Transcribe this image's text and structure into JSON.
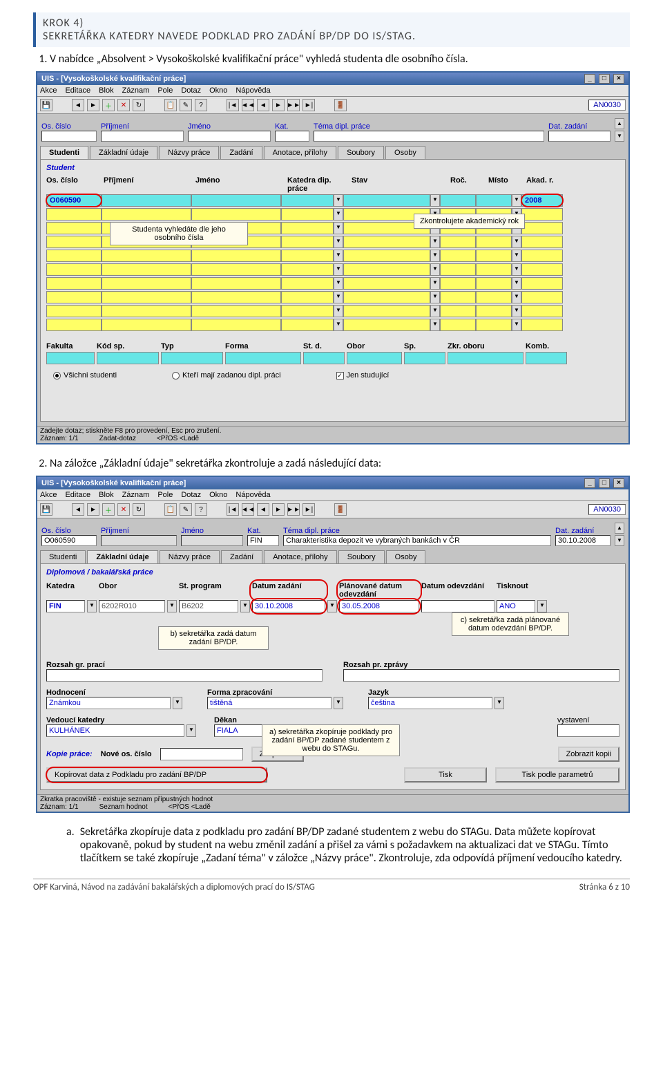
{
  "heading": {
    "step": "KROK 4)",
    "title": "SEKRETÁŘKA KATEDRY NAVEDE PODKLAD PRO ZADÁNÍ BP/DP DO IS/STAG."
  },
  "body": {
    "item1": "V nabídce „Absolvent > Vysokoškolské kvalifikační práce\" vyhledá studenta dle osobního čísla.",
    "item2": "Na záložce „Základní údaje\" sekretářka zkontroluje a zadá následující data:",
    "point_a": "Sekretářka zkopíruje data z podkladu pro zadání BP/DP zadané studentem z webu do STAGu. Data můžete kopírovat opakovaně, pokud by student na webu změnil zadání a přišel za vámi s požadavkem na aktualizaci dat ve STAGu. Tímto tlačítkem se také zkopíruje „Zadaní téma\" v záložce „Názvy práce\". Zkontroluje, zda odpovídá příjmení vedoucího katedry."
  },
  "uis": {
    "title": "UIS - [Vysokoškolské kvalifikační práce]",
    "menubar": [
      "Akce",
      "Editace",
      "Blok",
      "Záznam",
      "Pole",
      "Dotaz",
      "Okno",
      "Nápověda"
    ],
    "code": "AN0030",
    "query": {
      "os_cislo": "Os. číslo",
      "prijmeni": "Příjmení",
      "jmeno": "Jméno",
      "kat": "Kat.",
      "tema": "Téma dipl. práce",
      "dat_zadani": "Dat. zadání"
    },
    "tabs": [
      "Studenti",
      "Základní údaje",
      "Názvy práce",
      "Zadání",
      "Anotace, přílohy",
      "Soubory",
      "Osoby"
    ],
    "s1": {
      "groupTitle": "Student",
      "cols": [
        "Os. číslo",
        "Příjmení",
        "Jméno",
        "Katedra dip. práce",
        "Stav",
        "Roč.",
        "Místo",
        "Akad. r."
      ],
      "os_cislo_val": "O060590",
      "akad_r_val": "2008",
      "callout1": "Studenta vyhledáte dle jeho osobního čísla",
      "callout2": "Zkontrolujete akademický rok",
      "filter_cols": [
        "Fakulta",
        "Kód sp.",
        "Typ",
        "Forma",
        "St. d.",
        "Obor",
        "Sp.",
        "Zkr. oboru",
        "Komb."
      ],
      "radio1": "Všichni studenti",
      "radio2": "Kteří mají zadanou dipl. práci",
      "radio3": "Jen studující",
      "status1": "Zadejte dotaz; stiskněte F8 pro provedení, Esc pro zrušení.",
      "status2a": "Záznam: 1/1",
      "status2b": "Zadat-dotaz",
      "status2c": "<PřOS <Ladě"
    },
    "s2": {
      "q_os_cislo": "O060590",
      "q_kat": "FIN",
      "q_tema": "Charakteristika depozit ve vybraných bankách v ČR",
      "q_dat": "30.10.2008",
      "groupTitle": "Diplomová / bakalářská práce",
      "labels": {
        "katedra": "Katedra",
        "obor": "Obor",
        "stprog": "St. program",
        "datum_zadani": "Datum zadání",
        "planovane": "Plánované datum odevzdání",
        "datum_odevzdani": "Datum odevzdání",
        "tisknout": "Tisknout",
        "rozsah_gr": "Rozsah gr. prací",
        "rozsah_pr": "Rozsah pr. zprávy",
        "hodnoceni": "Hodnocení",
        "forma": "Forma zpracování",
        "jazyk": "Jazyk",
        "vedouci": "Vedoucí katedry",
        "dekan": "Děkan",
        "vystaveni": "vystavení",
        "kopie": "Kopie práce:",
        "nove_os": "Nové os. číslo",
        "btn_kopirovat": "Zkopírovat",
        "btn_zobrazit": "Zobrazit kopii",
        "btn_kopdata": "Kopírovat data z Podkladu pro zadání BP/DP",
        "btn_tisk": "Tisk",
        "btn_tisk_param": "Tisk podle parametrů"
      },
      "values": {
        "katedra": "FIN",
        "obor": "6202R010",
        "stprog": "B6202",
        "datum_zadani": "30.10.2008",
        "planovane": "30.05.2008",
        "datum_odevzdani": "",
        "tisknout": "ANO",
        "hodnoceni": "Známkou",
        "forma": "tištěná",
        "jazyk": "čeština",
        "vedouci": "KULHÁNEK",
        "dekan": "FIALA"
      },
      "callout_a": "a) sekretářka zkopíruje podklady pro zadání BP/DP zadané studentem z webu do STAGu.",
      "callout_b": "b) sekretářka zadá datum zadání BP/DP.",
      "callout_c": "c) sekretářka zadá plánované datum odevzdání BP/DP.",
      "status1": "Zkratka pracoviště - existuje seznam přípustných hodnot",
      "status2a": "Záznam: 1/1",
      "status2b": "Seznam hodnot",
      "status2c": "<PřOS <Ladě"
    }
  },
  "footer": {
    "left": "OPF Karviná, Návod na zadávání bakalářských a diplomových prací do IS/STAG",
    "right": "Stránka 6 z 10"
  },
  "chart_data": null
}
